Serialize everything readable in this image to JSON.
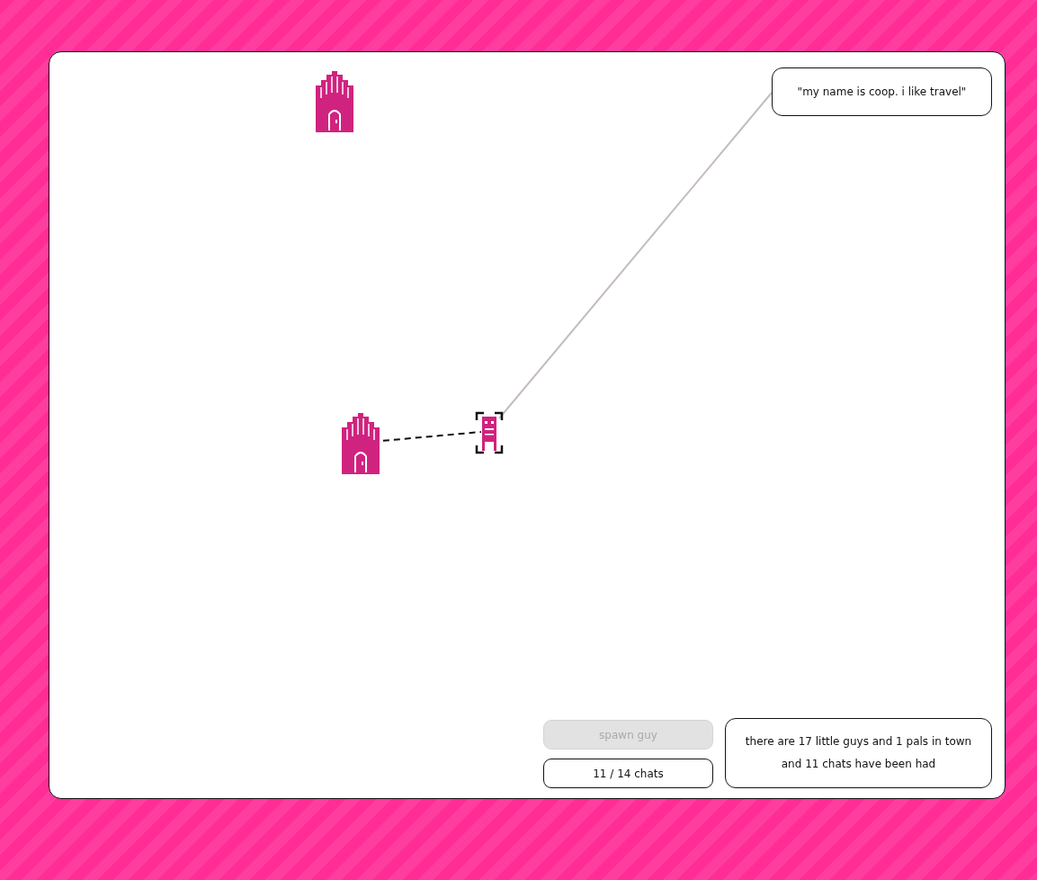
{
  "speech_bubble": {
    "text": "\"my name is coop. i like travel\""
  },
  "spawn_button": {
    "label": "spawn guy",
    "disabled": true
  },
  "chat_counter": {
    "text": "11 / 14 chats"
  },
  "status": {
    "text": "there are 17 little guys and 1 pals in town and 11 chats have been had"
  }
}
